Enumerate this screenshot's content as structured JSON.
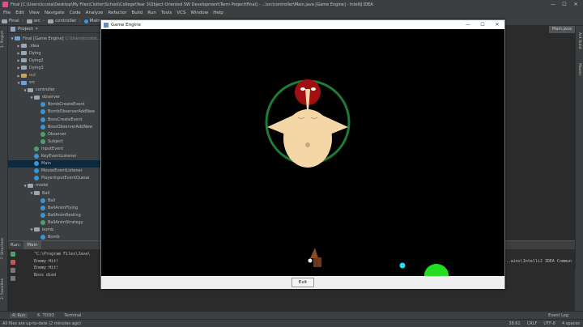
{
  "window": {
    "title": "Final [C:\\Users\\iccota\\Desktop\\My Files\\Clutter\\School\\College\\Year 3\\Object Oriented SW Development\\Term Project\\Final] - ...\\src\\controller\\Main.java [Game Engine] - IntelliJ IDEA",
    "controls": [
      "—",
      "☐",
      "✕"
    ]
  },
  "menu": [
    "File",
    "Edit",
    "View",
    "Navigate",
    "Code",
    "Analyze",
    "Refactor",
    "Build",
    "Run",
    "Tools",
    "VCS",
    "Window",
    "Help"
  ],
  "breadcrumbs": [
    "Final",
    "src",
    "controller",
    "Main"
  ],
  "side_tabs": {
    "left": [
      "1: Project",
      "7: Structure",
      "2: Favorites"
    ],
    "right": [
      "Ant Build",
      "Maven"
    ]
  },
  "project_panel": {
    "title": "Project",
    "tree": [
      {
        "label": "Final [Game Engine]",
        "path": "C:\\Users\\iccota\\...",
        "indent": 0,
        "icon": "folder-blue",
        "arrow": "▼"
      },
      {
        "label": ".idea",
        "indent": 1,
        "icon": "folder",
        "arrow": "▶"
      },
      {
        "label": "Dying",
        "indent": 1,
        "icon": "folder",
        "arrow": "▶"
      },
      {
        "label": "Dying2",
        "indent": 1,
        "icon": "folder",
        "arrow": "▶"
      },
      {
        "label": "Dying3",
        "indent": 1,
        "icon": "folder",
        "arrow": "▶"
      },
      {
        "label": "out",
        "indent": 1,
        "icon": "folder-orange",
        "arrow": "▶",
        "orange": true
      },
      {
        "label": "src",
        "indent": 1,
        "icon": "folder-blue",
        "arrow": "▼"
      },
      {
        "label": "controller",
        "indent": 2,
        "icon": "folder",
        "arrow": "▼"
      },
      {
        "label": "observer",
        "indent": 3,
        "icon": "folder",
        "arrow": "▼"
      },
      {
        "label": "BombCreateEvent",
        "indent": 4,
        "icon": "class"
      },
      {
        "label": "BombObserverAddNew",
        "indent": 4,
        "icon": "class"
      },
      {
        "label": "BossCreateEvent",
        "indent": 4,
        "icon": "class"
      },
      {
        "label": "BossObserverAddNew",
        "indent": 4,
        "icon": "class"
      },
      {
        "label": "Observer",
        "indent": 4,
        "icon": "class-green"
      },
      {
        "label": "Subject",
        "indent": 4,
        "icon": "class-green"
      },
      {
        "label": "InputEvent",
        "indent": 3,
        "icon": "class-green"
      },
      {
        "label": "KeyEventListener",
        "indent": 3,
        "icon": "class"
      },
      {
        "label": "Main",
        "indent": 3,
        "icon": "class",
        "selected": true
      },
      {
        "label": "MouseEventListener",
        "indent": 3,
        "icon": "class"
      },
      {
        "label": "PlayerInputEventQueue",
        "indent": 3,
        "icon": "class"
      },
      {
        "label": "model",
        "indent": 2,
        "icon": "folder",
        "arrow": "▼"
      },
      {
        "label": "Ball",
        "indent": 3,
        "icon": "folder",
        "arrow": "▼"
      },
      {
        "label": "Ball",
        "indent": 4,
        "icon": "class"
      },
      {
        "label": "BallAnimFlying",
        "indent": 4,
        "icon": "class"
      },
      {
        "label": "BallAnimResting",
        "indent": 4,
        "icon": "class"
      },
      {
        "label": "BallAnimStrategy",
        "indent": 4,
        "icon": "class-green"
      },
      {
        "label": "bomb",
        "indent": 3,
        "icon": "folder",
        "arrow": "▼"
      },
      {
        "label": "Bomb",
        "indent": 4,
        "icon": "class"
      }
    ]
  },
  "editor": {
    "tab_label": "Main.java"
  },
  "run_panel": {
    "label": "Run:",
    "tab": "Main",
    "console_lines": [
      "\"C:\\Program Files\\Java\\",
      "Enemy Hit!",
      "Enemy Hit!",
      "Boss died"
    ],
    "console_right": "...ains\\IntelliJ IDEA Commun"
  },
  "bottom_tabs": [
    "4: Run",
    "6: TODO",
    "Terminal"
  ],
  "bottom_right": "Event Log",
  "status": {
    "message": "All files are up-to-date (2 minutes ago)",
    "right": [
      "38:61",
      "CRLF",
      "UTF-8",
      "4 spaces"
    ]
  },
  "game_window": {
    "title": "Game Engine",
    "exit_label": "Exit"
  },
  "colors": {
    "ide_bg": "#3c3f41",
    "editor_bg": "#2b2b2b",
    "boss_ring": "#1f7a35",
    "boss_body": "#f5d6a6",
    "boss_head": "#a01010",
    "projectile": "#ffffff",
    "cyan_orb": "#20e0f0",
    "green_blob": "#22dd22"
  }
}
